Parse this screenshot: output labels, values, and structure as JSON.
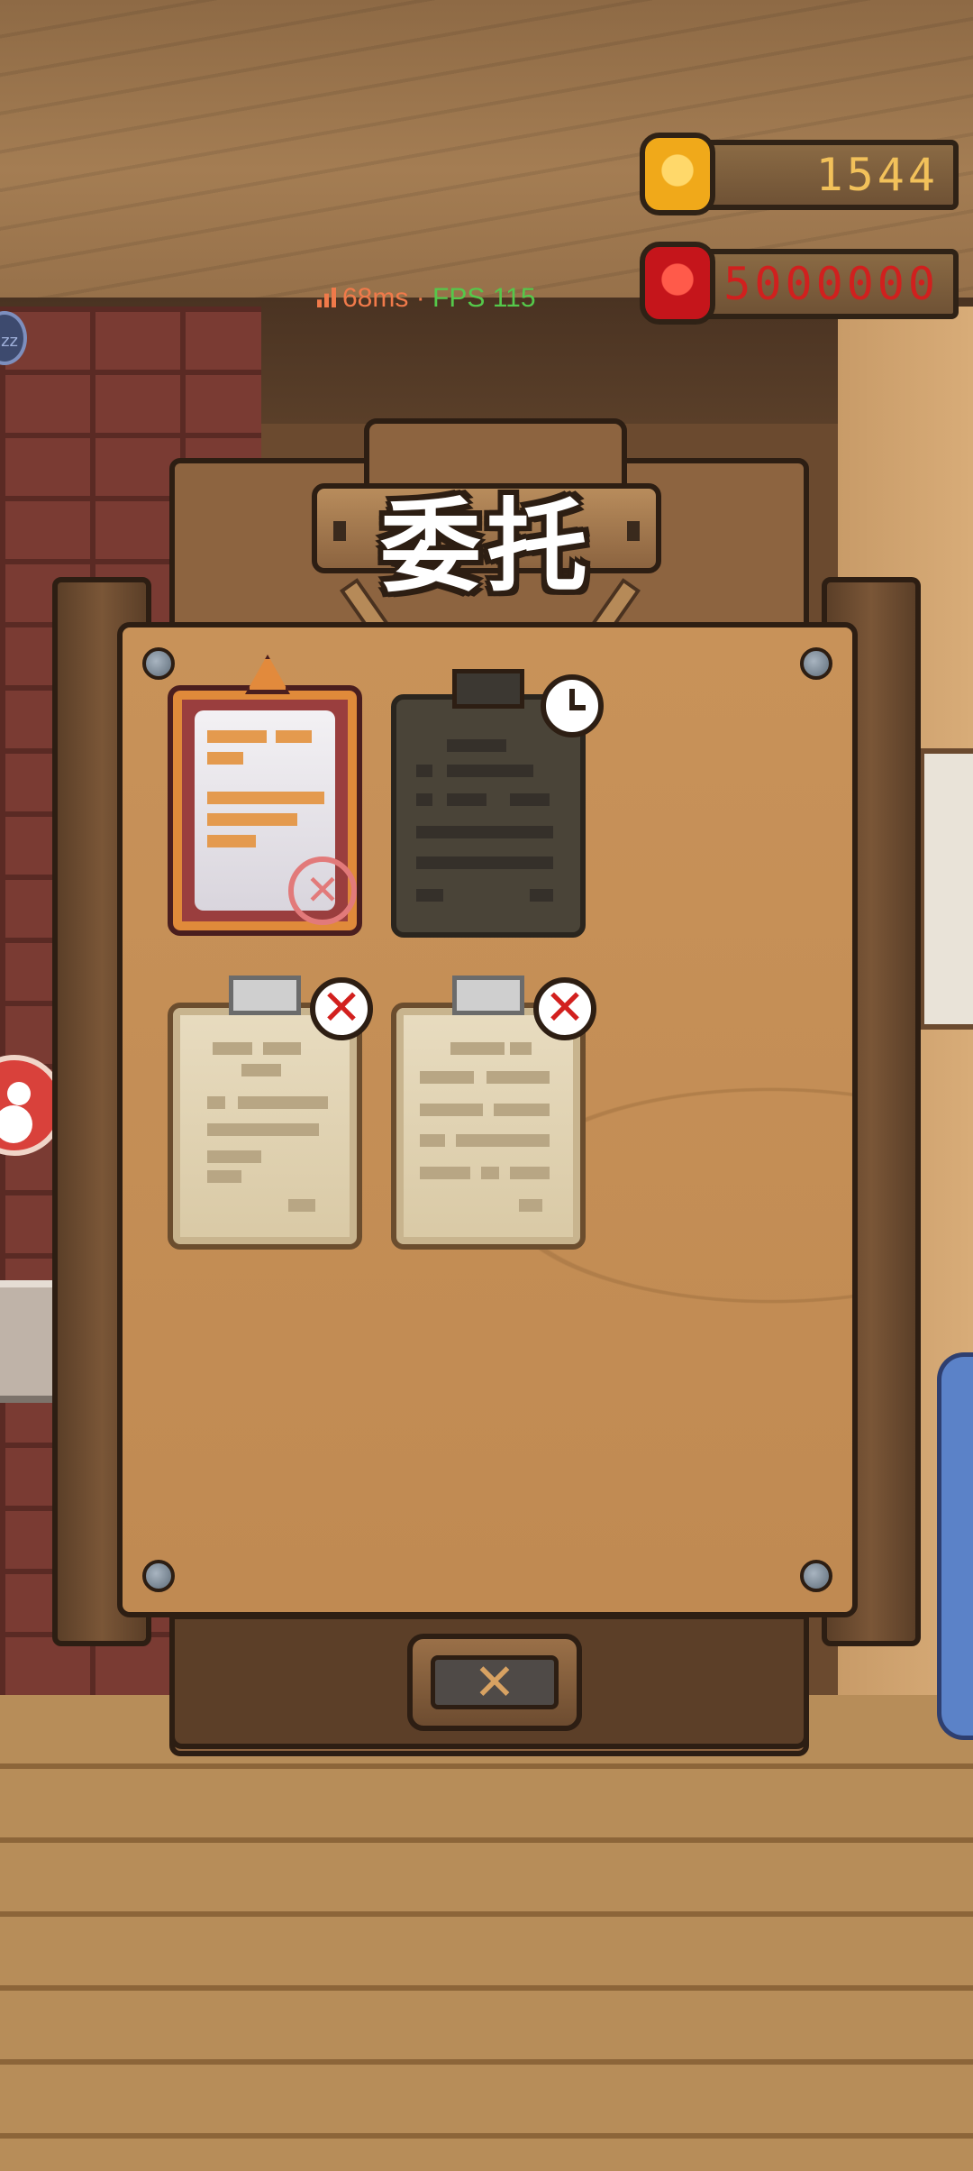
{
  "hud": {
    "coins": {
      "value": "1544",
      "icon": "gold-coin-icon",
      "color": "#f2c15a"
    },
    "gems": {
      "value": "5000000",
      "icon": "red-gem-icon",
      "color": "#d0201e"
    }
  },
  "perf": {
    "latency": "68ms",
    "separator": "·",
    "fps": "FPS 115"
  },
  "board": {
    "title": "委托",
    "close_icon": "close-x-icon"
  },
  "quests": [
    {
      "state": "active",
      "icon": "stamp-icon",
      "stamp": "✕"
    },
    {
      "state": "locked",
      "icon": "clock-icon"
    },
    {
      "state": "declined",
      "icon": "x-badge-icon",
      "badge": "✕"
    },
    {
      "state": "declined",
      "icon": "x-badge-icon",
      "badge": "✕"
    }
  ],
  "side": {
    "badge": "zz"
  },
  "colors": {
    "accent": "#e08a3a",
    "board": "#c08a52",
    "danger": "#d2201e"
  }
}
